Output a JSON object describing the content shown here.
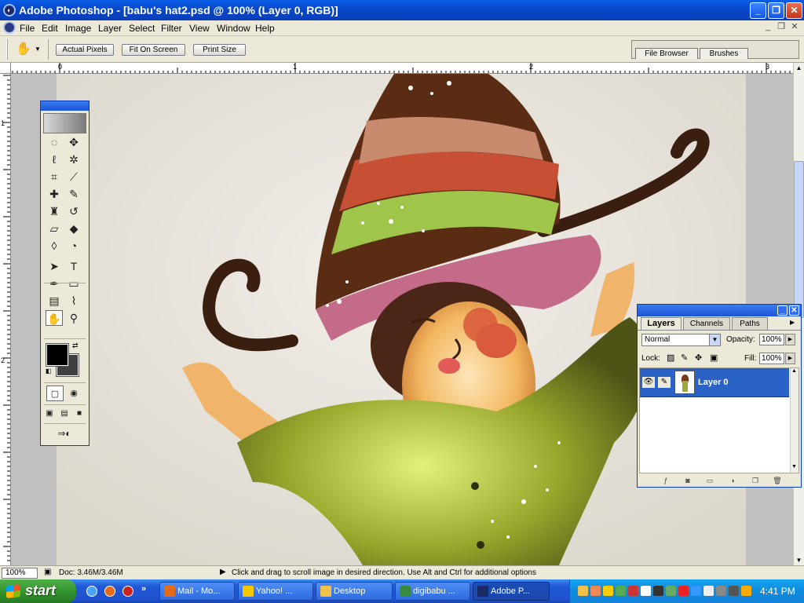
{
  "window": {
    "title": "Adobe Photoshop - [babu's hat2.psd @ 100% (Layer 0, RGB)]",
    "minimize": "_",
    "restore": "❐",
    "close": "✕"
  },
  "menu": [
    "File",
    "Edit",
    "Image",
    "Layer",
    "Select",
    "Filter",
    "View",
    "Window",
    "Help"
  ],
  "document_controls": {
    "minimize": "_",
    "restore": "❐",
    "close": "✕"
  },
  "options_bar": {
    "buttons": [
      "Actual Pixels",
      "Fit On Screen",
      "Print Size"
    ],
    "palette_well_tabs": [
      "File Browser",
      "Brushes"
    ]
  },
  "rulers": {
    "top_labels": [
      "0",
      "1",
      "2",
      "3"
    ],
    "left_labels": [
      "1",
      "2"
    ]
  },
  "document": {
    "name": "babu's hat2.psd",
    "zoom": "100%",
    "layer": "Layer 0",
    "mode": "RGB"
  },
  "colors": {
    "foreground": "#000000",
    "background": "#404040",
    "xp_blue": "#0a5ee8"
  },
  "toolbox": {
    "tools": [
      {
        "name": "marquee-tool-icon",
        "glyph": "◌"
      },
      {
        "name": "move-tool-icon",
        "glyph": "✥"
      },
      {
        "name": "lasso-tool-icon",
        "glyph": "ℓ"
      },
      {
        "name": "magic-wand-icon",
        "glyph": "✲"
      },
      {
        "name": "crop-tool-icon",
        "glyph": "⌗"
      },
      {
        "name": "slice-tool-icon",
        "glyph": "⟋"
      },
      {
        "name": "healing-brush-icon",
        "glyph": "✚"
      },
      {
        "name": "brush-tool-icon",
        "glyph": "✎"
      },
      {
        "name": "clone-stamp-icon",
        "glyph": "♜"
      },
      {
        "name": "history-brush-icon",
        "glyph": "↺"
      },
      {
        "name": "eraser-tool-icon",
        "glyph": "▱"
      },
      {
        "name": "paint-bucket-icon",
        "glyph": "◆"
      },
      {
        "name": "blur-tool-icon",
        "glyph": "◊"
      },
      {
        "name": "dodge-tool-icon",
        "glyph": "◔"
      },
      {
        "name": "path-selection-icon",
        "glyph": "➤"
      },
      {
        "name": "type-tool-icon",
        "glyph": "T"
      },
      {
        "name": "pen-tool-icon",
        "glyph": "✒"
      },
      {
        "name": "rectangle-tool-icon",
        "glyph": "▭"
      },
      {
        "name": "notes-tool-icon",
        "glyph": "▤"
      },
      {
        "name": "eyedropper-tool-icon",
        "glyph": "⌇"
      },
      {
        "name": "hand-tool-icon",
        "glyph": "✋"
      },
      {
        "name": "zoom-tool-icon",
        "glyph": "⚲"
      }
    ],
    "mode_icons": [
      "standard-mode-icon",
      "quickmask-mode-icon"
    ],
    "screen_icons": [
      "standard-screen-icon",
      "fullscreen-menu-icon",
      "fullscreen-icon"
    ],
    "jump_icons": [
      "imageready-jump-icon"
    ]
  },
  "status": {
    "zoom": "100%",
    "doc": "Doc: 3.46M/3.46M",
    "hint": "Click and drag to scroll image in desired direction.  Use Alt and Ctrl for additional options"
  },
  "layers_panel": {
    "tabs": [
      "Layers",
      "Channels",
      "Paths"
    ],
    "blend_mode": "Normal",
    "opacity_label": "Opacity:",
    "opacity": "100%",
    "lock_label": "Lock:",
    "fill_label": "Fill:",
    "fill": "100%",
    "layers": [
      {
        "name": "Layer 0",
        "visible": true,
        "selected": true
      }
    ]
  },
  "taskbar": {
    "start": "start",
    "tasks": [
      {
        "label": "Mail - Mo...",
        "color": "#e66a1a"
      },
      {
        "label": "Yahoo! ...",
        "color": "#f5c800"
      },
      {
        "label": "Desktop",
        "color": "#f3c24a"
      },
      {
        "label": "digibabu ...",
        "color": "#3a8a40"
      },
      {
        "label": "Adobe P...",
        "color": "#1b2a66",
        "active": true
      }
    ],
    "clock": "4:41 PM"
  }
}
